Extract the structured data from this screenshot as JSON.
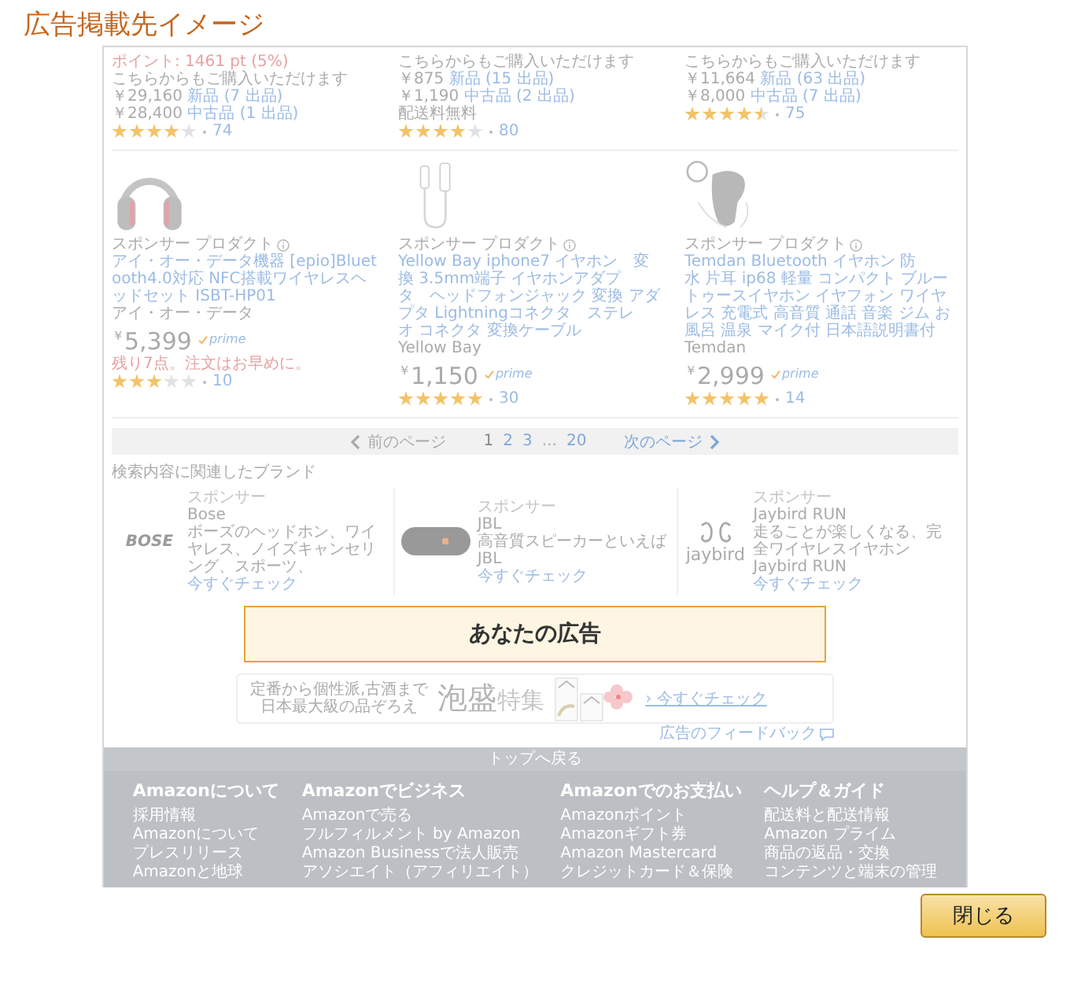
{
  "title": "広告掲載先イメージ",
  "offers_row": [
    {
      "points": "ポイント: 1461 pt (5%)",
      "note": "こちらからもご購入いただけます",
      "offers": [
        {
          "price": "￥29,160",
          "link": "新品 (7 出品)"
        },
        {
          "price": "￥28,400",
          "link": "中古品 (1 出品)"
        }
      ],
      "stars": 4,
      "review_count": "74"
    },
    {
      "note": "こちらからもご購入いただけます",
      "offers": [
        {
          "price": "￥875",
          "link": "新品 (15 出品)"
        },
        {
          "price": "￥1,190",
          "link": "中古品 (2 出品)"
        }
      ],
      "shipping": "配送料無料",
      "stars": 4,
      "review_count": "80"
    },
    {
      "note": "こちらからもご購入いただけます",
      "offers": [
        {
          "price": "￥11,664",
          "link": "新品 (63 出品)"
        },
        {
          "price": "￥8,000",
          "link": "中古品 (7 出品)"
        }
      ],
      "stars": 4.5,
      "review_count": "75"
    }
  ],
  "products": [
    {
      "kind": "headphones",
      "sponsor": "スポンサー プロダクト",
      "title": "アイ・オー・データ機器 [epio]Bluetooth4.0対応 NFC搭載ワイヤレスヘッドセット ISBT-HP01",
      "brand": "アイ・オー・データ",
      "price": "$^{￥}$5,399",
      "prime_badge": "prime",
      "stock_note": "残り7点。注文はお早めに。",
      "stars": 3,
      "review_count": "10"
    },
    {
      "kind": "cable",
      "sponsor": "スポンサー プロダクト",
      "title": "Yellow Bay iphone7 イヤホン　変換 3.5mm端子 イヤホンアダプタ　ヘッドフォンジャック 変換 アダプタ Lightningコネクタ　ステレオ コネクタ 変換ケーブル",
      "brand": "Yellow Bay",
      "price": "$^{￥}$1,150",
      "prime_badge": "prime",
      "stars": 5,
      "review_count": "30"
    },
    {
      "kind": "earbud",
      "sponsor": "スポンサー プロダクト",
      "title": "Temdan Bluetooth イヤホン 防水 片耳 ip68 軽量 コンパクト ブルートゥースイヤホン イヤフォン ワイヤレス 充電式 高音質 通話 音楽 ジム お風呂 温泉 マイク付 日本語説明書付",
      "brand": "Temdan",
      "price": "$^{￥}$2,999",
      "prime_badge": "prime",
      "stars": 5,
      "review_count": "14"
    }
  ],
  "pagination": {
    "previous": {
      "label": "前のページ",
      "disabled": true
    },
    "items": [
      {
        "kind": "page",
        "label": "1",
        "selected": true
      },
      {
        "kind": "page",
        "label": "2",
        "selected": false
      },
      {
        "kind": "page",
        "label": "3",
        "selected": false
      },
      {
        "kind": "ellipsis",
        "label": "..."
      },
      {
        "kind": "page",
        "label": "20",
        "selected": false
      }
    ],
    "next": {
      "label": "次のページ",
      "disabled": false
    }
  },
  "brands": {
    "heading": "検索内容に関連したブランド",
    "items": [
      {
        "kind": "bose",
        "logo_text": "BOSE",
        "sponsor": "スポンサー",
        "name": "Bose",
        "description": "ボーズのヘッドホン、ワイヤレス、ノイズキャンセリング、スポーツ、",
        "link": "今すぐチェック"
      },
      {
        "kind": "jbl",
        "sponsor": "スポンサー",
        "name": "JBL",
        "description": "高音質スピーカーといえばJBL",
        "link": "今すぐチェック"
      },
      {
        "kind": "jaybird",
        "logo_text": "jaybird",
        "sponsor": "スポンサー",
        "name": "Jaybird RUN",
        "description": "走ることが楽しくなる、完全ワイヤレスイヤホン Jaybird RUN",
        "link": "今すぐチェック"
      }
    ]
  },
  "ad_slot": {
    "label": "あなたの広告"
  },
  "banner": {
    "tagline": [
      "定番から個性派,古酒まで",
      "日本最大級の品ぞろえ"
    ],
    "headline": "**泡盛**特集",
    "link": "› 今すぐチェック"
  },
  "feedback": "広告のフィードバック",
  "footer": {
    "back_to_top": "トップへ戻る",
    "columns": [
      {
        "heading": "Amazonについて",
        "links": [
          "採用情報",
          "Amazonについて",
          "プレスリリース",
          "Amazonと地球"
        ]
      },
      {
        "heading": "Amazonでビジネス",
        "links": [
          "Amazonで売る",
          "フルフィルメント by Amazon",
          "Amazon Businessで法人販売",
          "アソシエイト（アフィリエイト）"
        ]
      },
      {
        "heading": "Amazonでのお支払い",
        "links": [
          "Amazonポイント",
          "Amazonギフト券",
          "Amazon Mastercard",
          "クレジットカード＆保険"
        ]
      },
      {
        "heading": "ヘルプ＆ガイド",
        "links": [
          "配送料と配送情報",
          "Amazon プライム",
          "商品の返品・交換",
          "コンテンツと端末の管理"
        ]
      }
    ]
  },
  "close_button": "閉じる"
}
